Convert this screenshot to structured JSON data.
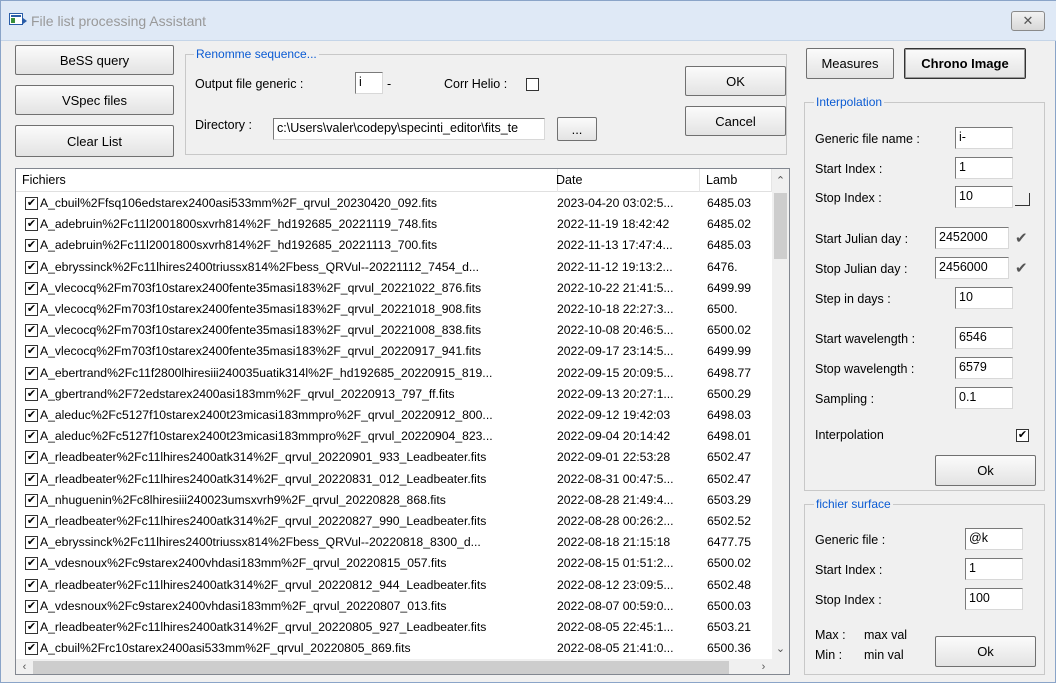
{
  "window": {
    "title": "File list processing Assistant",
    "close_glyph": "✕"
  },
  "left_buttons": {
    "bess_query": "BeSS query",
    "vspec_files": "VSpec files",
    "clear_list": "Clear List"
  },
  "rename": {
    "legend": "Renomme sequence...",
    "output_label": "Output file generic :",
    "output_value": "i",
    "output_suffix": "-",
    "corr_helio_label": "Corr Helio :",
    "directory_label": "Directory :",
    "directory_value": "c:\\Users\\valer\\codepy\\specinti_editor\\fits_te",
    "browse_label": "...",
    "ok_label": "OK",
    "cancel_label": "Cancel"
  },
  "top_right": {
    "measures": "Measures",
    "chrono_image": "Chrono Image"
  },
  "interpolation": {
    "legend": "Interpolation",
    "generic_name_label": "Generic file name :",
    "generic_name_value": "i-",
    "start_index_label": "Start Index :",
    "start_index_value": "1",
    "stop_index_label": "Stop Index :",
    "stop_index_value": "10",
    "start_julian_label": "Start Julian day :",
    "start_julian_value": "2452000",
    "stop_julian_label": "Stop Julian day :",
    "stop_julian_value": "2456000",
    "step_days_label": "Step in days :",
    "step_days_value": "10",
    "start_wl_label": "Start wavelength :",
    "start_wl_value": "6546",
    "stop_wl_label": "Stop wavelength :",
    "stop_wl_value": "6579",
    "sampling_label": "Sampling :",
    "sampling_value": "0.1",
    "interp_label": "Interpolation",
    "ok_label": "Ok"
  },
  "surface": {
    "legend": "fichier surface",
    "generic_label": "Generic file :",
    "generic_value": "@k",
    "start_index_label": "Start Index :",
    "start_index_value": "1",
    "stop_index_label": "Stop Index :",
    "stop_index_value": "100",
    "max_label": "Max :",
    "max_value": "max val",
    "min_label": "Min :",
    "min_value": "min val",
    "ok_label": "Ok"
  },
  "list": {
    "headers": [
      "Fichiers",
      "Date",
      "Lamb"
    ],
    "check_glyph": "✔",
    "rows": [
      [
        "A_cbuil%2Ffsq106edstarex2400asi533mm%2F_qrvul_20230420_092.fits",
        "2023-04-20 03:02:5...",
        "6485.03"
      ],
      [
        "A_adebruin%2Fc11l2001800sxvrh814%2F_hd192685_20221119_748.fits",
        "2022-11-19 18:42:42",
        "6485.02"
      ],
      [
        "A_adebruin%2Fc11l2001800sxvrh814%2F_hd192685_20221113_700.fits",
        "2022-11-13 17:47:4...",
        "6485.03"
      ],
      [
        "A_ebryssinck%2Fc11lhires2400triussx814%2Fbess_QRVul--20221112_7454_d...",
        "2022-11-12 19:13:2...",
        "6476."
      ],
      [
        "A_vlecocq%2Fm703f10starex2400fente35masi183%2F_qrvul_20221022_876.fits",
        "2022-10-22 21:41:5...",
        "6499.99"
      ],
      [
        "A_vlecocq%2Fm703f10starex2400fente35masi183%2F_qrvul_20221018_908.fits",
        "2022-10-18 22:27:3...",
        "6500."
      ],
      [
        "A_vlecocq%2Fm703f10starex2400fente35masi183%2F_qrvul_20221008_838.fits",
        "2022-10-08 20:46:5...",
        "6500.02"
      ],
      [
        "A_vlecocq%2Fm703f10starex2400fente35masi183%2F_qrvul_20220917_941.fits",
        "2022-09-17 23:14:5...",
        "6499.99"
      ],
      [
        "A_ebertrand%2Fc11f2800lhiresiii240035uatik314l%2F_hd192685_20220915_819...",
        "2022-09-15 20:09:5...",
        "6498.77"
      ],
      [
        "A_gbertrand%2F72edstarex2400asi183mm%2F_qrvul_20220913_797_ff.fits",
        "2022-09-13 20:27:1...",
        "6500.29"
      ],
      [
        "A_aleduc%2Fc5127f10starex2400t23micasi183mmpro%2F_qrvul_20220912_800...",
        "2022-09-12 19:42:03",
        "6498.03"
      ],
      [
        "A_aleduc%2Fc5127f10starex2400t23micasi183mmpro%2F_qrvul_20220904_823...",
        "2022-09-04 20:14:42",
        "6498.01"
      ],
      [
        "A_rleadbeater%2Fc11lhires2400atk314%2F_qrvul_20220901_933_Leadbeater.fits",
        "2022-09-01 22:53:28",
        "6502.47"
      ],
      [
        "A_rleadbeater%2Fc11lhires2400atk314%2F_qrvul_20220831_012_Leadbeater.fits",
        "2022-08-31 00:47:5...",
        "6502.47"
      ],
      [
        "A_nhuguenin%2Fc8lhiresiii240023umsxvrh9%2F_qrvul_20220828_868.fits",
        "2022-08-28 21:49:4...",
        "6503.29"
      ],
      [
        "A_rleadbeater%2Fc11lhires2400atk314%2F_qrvul_20220827_990_Leadbeater.fits",
        "2022-08-28 00:26:2...",
        "6502.52"
      ],
      [
        "A_ebryssinck%2Fc11lhires2400triussx814%2Fbess_QRVul--20220818_8300_d...",
        "2022-08-18 21:15:18",
        "6477.75"
      ],
      [
        "A_vdesnoux%2Fc9starex2400vhdasi183mm%2F_qrvul_20220815_057.fits",
        "2022-08-15 01:51:2...",
        "6500.02"
      ],
      [
        "A_rleadbeater%2Fc11lhires2400atk314%2F_qrvul_20220812_944_Leadbeater.fits",
        "2022-08-12 23:09:5...",
        "6502.48"
      ],
      [
        "A_vdesnoux%2Fc9starex2400vhdasi183mm%2F_qrvul_20220807_013.fits",
        "2022-08-07 00:59:0...",
        "6500.03"
      ],
      [
        "A_rleadbeater%2Fc11lhires2400atk314%2F_qrvul_20220805_927_Leadbeater.fits",
        "2022-08-05 22:45:1...",
        "6503.21"
      ],
      [
        "A_cbuil%2Frc10starex2400asi533mm%2F_qrvul_20220805_869.fits",
        "2022-08-05 21:41:0...",
        "6500.36"
      ]
    ]
  }
}
